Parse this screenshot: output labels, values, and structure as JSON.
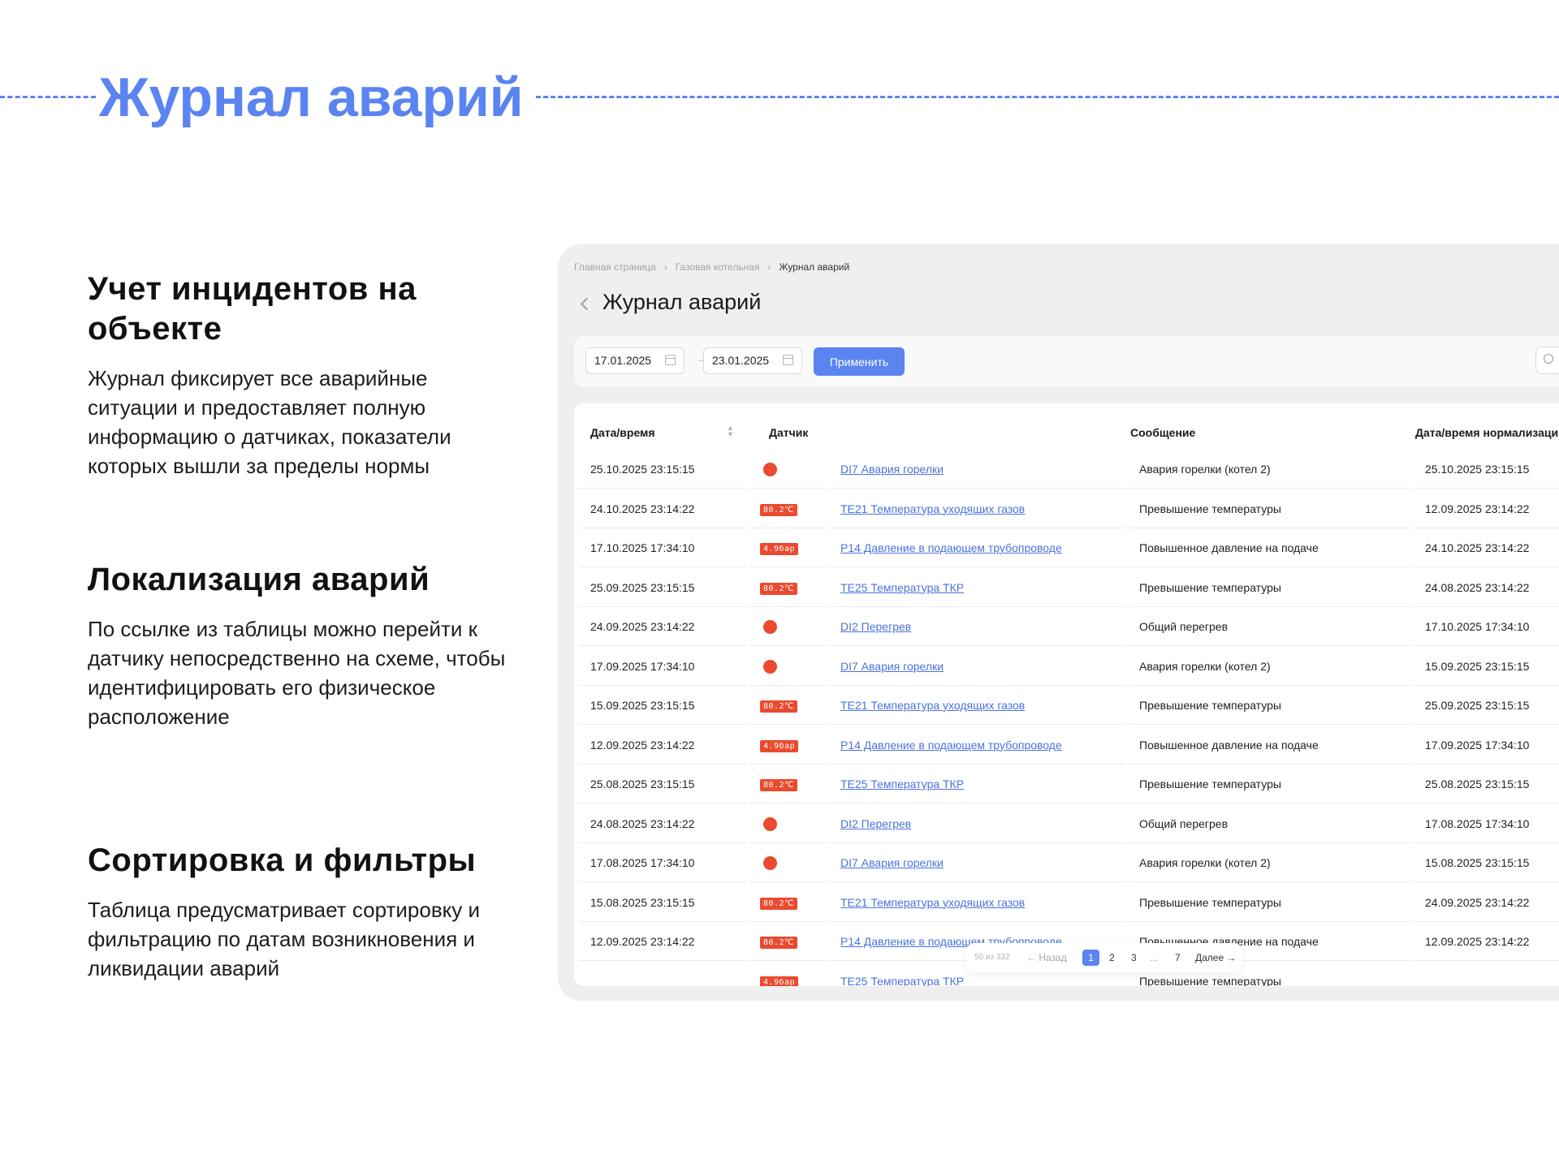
{
  "heading": "Журнал аварий",
  "features": [
    {
      "title": "Учет инцидентов на объекте",
      "text": "Журнал фиксирует все аварийные ситуации и предоставляет полную информацию о датчиках, показатели которых вышли за пределы нормы"
    },
    {
      "title": "Локализация аварий",
      "text": "По ссылке из таблицы можно перейти к датчику непосредственно на схеме, чтобы идентифицировать его физическое расположение"
    },
    {
      "title": "Сортировка и фильтры",
      "text": "Таблица предусматривает сортировку и фильтрацию по датам возникновения и ликвидации аварий"
    }
  ],
  "app": {
    "breadcrumbs": [
      "Главная страница",
      "Газовая котельная",
      "Журнал аварий"
    ],
    "title": "Журнал аварий",
    "filters": {
      "date_from": "17.01.2025",
      "date_to": "23.01.2025",
      "apply_label": "Применить"
    },
    "columns": [
      "Дата/время",
      "Датчик",
      "Сообщение",
      "Дата/время нормализации"
    ],
    "rows": [
      {
        "date": "25.10.2025 23:15:15",
        "type": "dot",
        "badge": "",
        "sensor": "DI7 Авария горелки",
        "message": "Авария горелки (котел 2)",
        "norm": "25.10.2025 23:15:15"
      },
      {
        "date": "24.10.2025 23:14:22",
        "type": "badge",
        "badge": "80.2℃",
        "sensor": "TE21 Температура уходящих газов",
        "message": "Превышение температуры",
        "norm": "12.09.2025 23:14:22"
      },
      {
        "date": "17.10.2025 17:34:10",
        "type": "badge",
        "badge": "4.9бар",
        "sensor": "P14 Давление в подающем трубопроводе",
        "message": "Повышенное давление на подаче",
        "norm": "24.10.2025 23:14:22"
      },
      {
        "date": "25.09.2025 23:15:15",
        "type": "badge",
        "badge": "80.2℃",
        "sensor": "TE25 Температура ТКР",
        "message": "Превышение температуры",
        "norm": "24.08.2025 23:14:22"
      },
      {
        "date": "24.09.2025 23:14:22",
        "type": "dot",
        "badge": "",
        "sensor": "DI2 Перегрев",
        "message": "Общий перегрев",
        "norm": "17.10.2025 17:34:10"
      },
      {
        "date": "17.09.2025 17:34:10",
        "type": "dot",
        "badge": "",
        "sensor": "DI7 Авария горелки",
        "message": "Авария горелки (котел 2)",
        "norm": "15.09.2025 23:15:15"
      },
      {
        "date": "15.09.2025 23:15:15",
        "type": "badge",
        "badge": "80.2℃",
        "sensor": "TE21 Температура уходящих газов",
        "message": "Превышение температуры",
        "norm": "25.09.2025 23:15:15"
      },
      {
        "date": "12.09.2025 23:14:22",
        "type": "badge",
        "badge": "4.9бар",
        "sensor": "P14 Давление в подающем трубопроводе",
        "message": "Повышенное давление на подаче",
        "norm": "17.09.2025 17:34:10"
      },
      {
        "date": "25.08.2025 23:15:15",
        "type": "badge",
        "badge": "80.2℃",
        "sensor": "TE25 Температура ТКР",
        "message": "Превышение температуры",
        "norm": "25.08.2025 23:15:15"
      },
      {
        "date": "24.08.2025 23:14:22",
        "type": "dot",
        "badge": "",
        "sensor": "DI2 Перегрев",
        "message": "Общий перегрев",
        "norm": "17.08.2025 17:34:10"
      },
      {
        "date": "17.08.2025 17:34:10",
        "type": "dot",
        "badge": "",
        "sensor": "DI7 Авария горелки",
        "message": "Авария горелки (котел 2)",
        "norm": "15.08.2025 23:15:15"
      },
      {
        "date": "15.08.2025 23:15:15",
        "type": "badge",
        "badge": "80.2℃",
        "sensor": "TE21 Температура уходящих газов",
        "message": "Превышение температуры",
        "norm": "24.09.2025 23:14:22"
      },
      {
        "date": "12.09.2025 23:14:22",
        "type": "badge",
        "badge": "80.2℃",
        "sensor": "P14 Давление в подающем трубопроводе",
        "message": "Повышенное давление на подаче",
        "norm": "12.09.2025 23:14:22"
      },
      {
        "date": "",
        "type": "badge",
        "badge": "4.9бар",
        "sensor": "TE25 Температура ТКР",
        "message": "Превышение температуры",
        "norm": ""
      }
    ],
    "pagination": {
      "summary": "50 из 332",
      "prev": "← Назад",
      "pages": [
        "1",
        "2",
        "3",
        "...",
        "7"
      ],
      "next": "Далее →",
      "active": "1"
    }
  },
  "colors": {
    "accent": "#5b84f0",
    "alarm": "#ea4a2e",
    "link": "#4a72e0"
  },
  "icons": {
    "back": "chevron-left-icon",
    "calendar": "calendar-icon",
    "search": "search-icon",
    "sort": "sort-icon"
  }
}
